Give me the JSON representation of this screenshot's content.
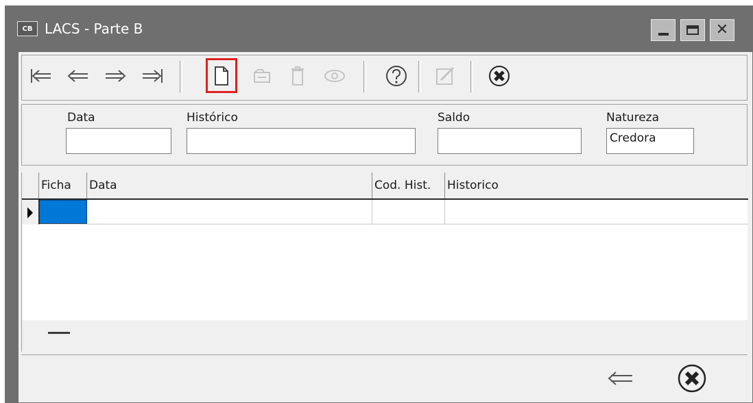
{
  "window": {
    "app_icon_text": "CB",
    "title": "LACS - Parte B"
  },
  "toolbar": {
    "buttons": [
      {
        "icon": "first-record-icon",
        "enabled": true
      },
      {
        "icon": "previous-record-icon",
        "enabled": true
      },
      {
        "icon": "next-record-icon",
        "enabled": true
      },
      {
        "icon": "last-record-icon",
        "enabled": true
      },
      {
        "icon": "new-document-icon",
        "enabled": true,
        "highlighted": true
      },
      {
        "icon": "edit-folder-icon",
        "enabled": false
      },
      {
        "icon": "delete-trash-icon",
        "enabled": false
      },
      {
        "icon": "view-eye-icon",
        "enabled": false
      },
      {
        "icon": "help-icon",
        "enabled": true
      },
      {
        "icon": "edit-pencil-icon",
        "enabled": false
      },
      {
        "icon": "close-x-icon",
        "enabled": true
      }
    ],
    "highlight_color": "#e02020"
  },
  "filter": {
    "data_label": "Data",
    "data_value": "",
    "historico_label": "Histórico",
    "historico_value": "",
    "saldo_label": "Saldo",
    "saldo_value": "",
    "natureza_label": "Natureza",
    "natureza_value": "Credora"
  },
  "grid": {
    "columns": [
      "Ficha",
      "Data",
      "Cod. Hist.",
      "Historico"
    ],
    "rows": [
      {
        "ficha": "",
        "data": "",
        "cod_hist": "",
        "historico": ""
      }
    ],
    "selection_color": "#0078d7"
  },
  "bottom": {
    "buttons": [
      {
        "icon": "back-arrow-icon"
      },
      {
        "icon": "close-x-icon"
      }
    ]
  }
}
